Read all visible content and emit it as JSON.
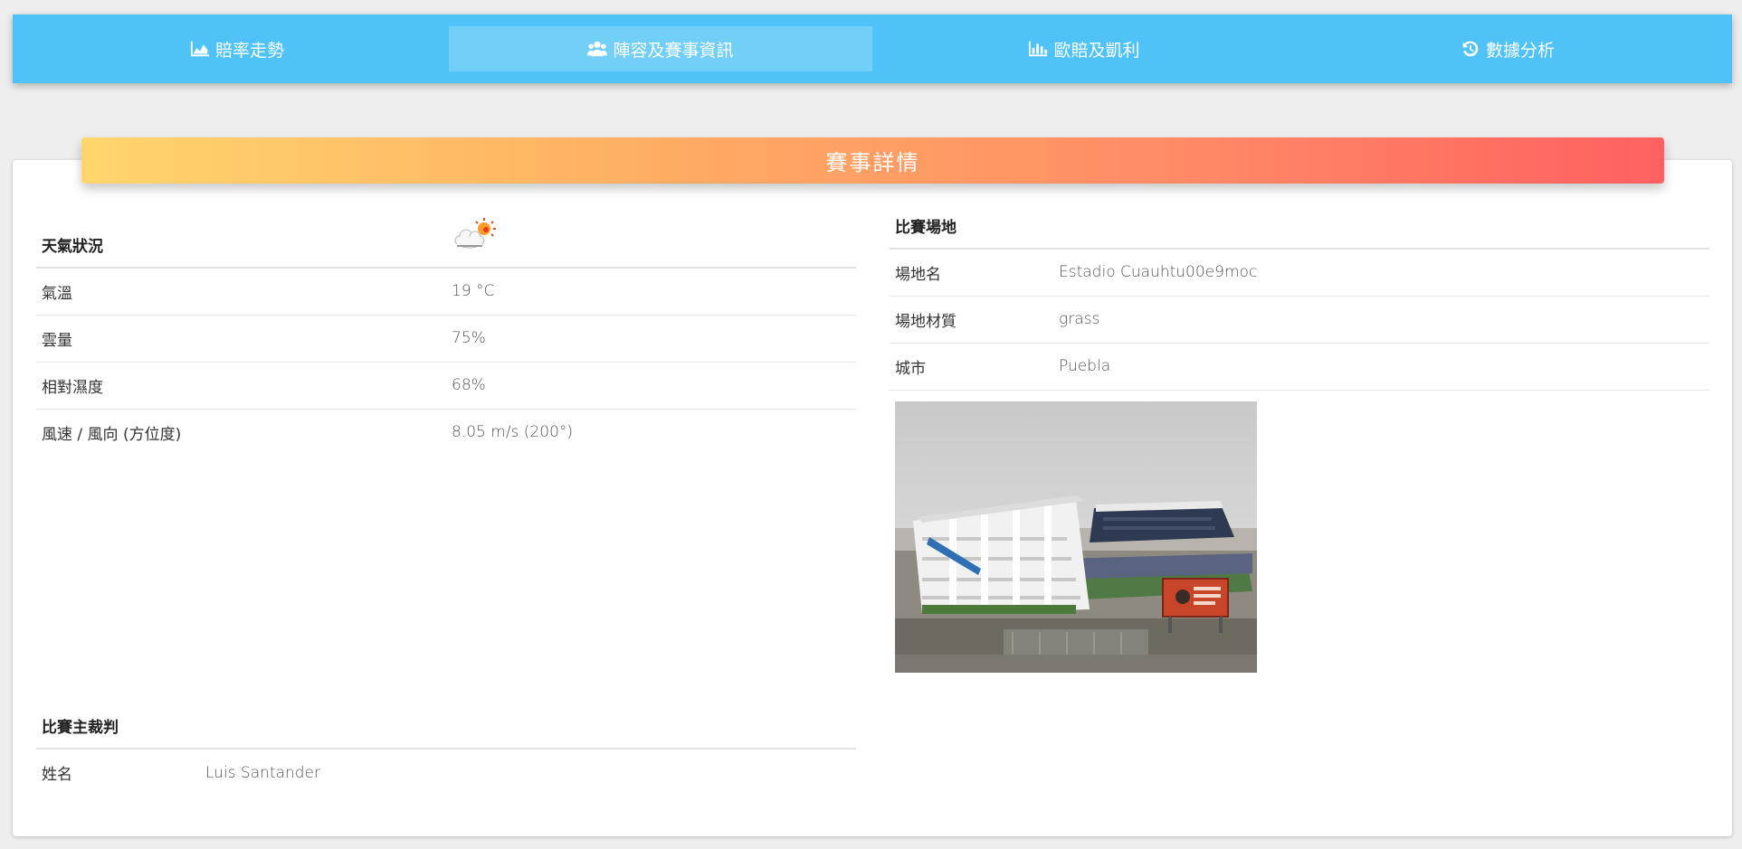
{
  "nav": {
    "tabs": [
      {
        "label": "賠率走勢",
        "icon": "area-chart-icon",
        "active": false
      },
      {
        "label": "陣容及賽事資訊",
        "icon": "users-icon",
        "active": true
      },
      {
        "label": "歐賠及凱利",
        "icon": "bar-chart-icon",
        "active": false
      },
      {
        "label": "數據分析",
        "icon": "history-icon",
        "active": false
      }
    ]
  },
  "card": {
    "title": "賽事詳情"
  },
  "weather": {
    "heading": "天氣狀況",
    "icon": "partly-cloudy-icon",
    "rows": [
      {
        "label": "氣溫",
        "value": "19 °C"
      },
      {
        "label": "雲量",
        "value": "75%"
      },
      {
        "label": "相對濕度",
        "value": "68%"
      },
      {
        "label": "風速 / 風向 (方位度)",
        "value": "8.05 m/s (200°)"
      }
    ]
  },
  "venue": {
    "heading": "比賽場地",
    "rows": [
      {
        "label": "場地名",
        "value": "Estadio Cuauhtu00e9moc"
      },
      {
        "label": "場地材質",
        "value": "grass"
      },
      {
        "label": "城市",
        "value": "Puebla"
      }
    ],
    "photo": "stadium-photo"
  },
  "referee": {
    "heading": "比賽主裁判",
    "rows": [
      {
        "label": "姓名",
        "value": "Luis Santander"
      }
    ]
  },
  "colors": {
    "nav_bg": "#4fc3f7",
    "header_gradient_start": "#ffd66c",
    "header_gradient_end": "#ff6060",
    "page_bg": "#eeeeee"
  }
}
